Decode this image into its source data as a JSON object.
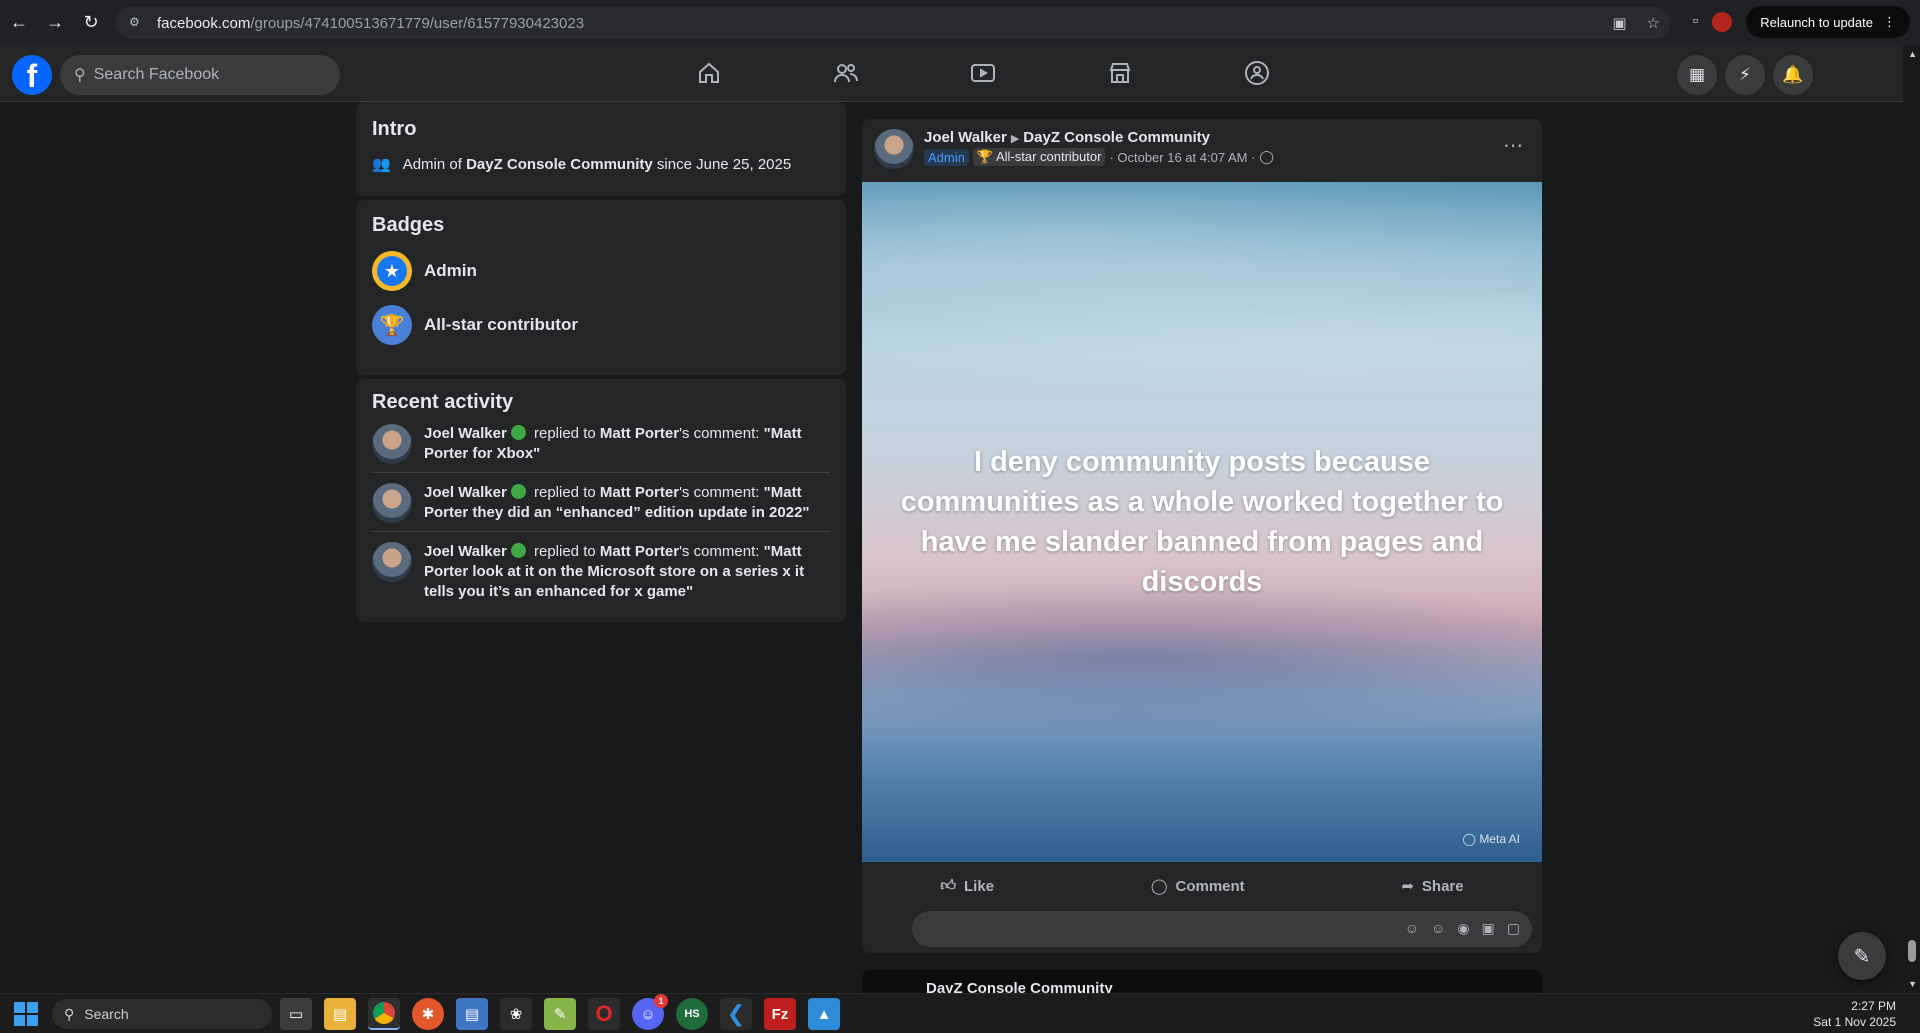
{
  "browser": {
    "url_host": "facebook.com",
    "url_path": "/groups/474100513671779/user/61577930423023",
    "relaunch_label": "Relaunch to update"
  },
  "header": {
    "search_placeholder": "Search Facebook",
    "nav": [
      "home",
      "friends",
      "watch",
      "marketplace",
      "groups"
    ]
  },
  "intro": {
    "title": "Intro",
    "prefix": "Admin of ",
    "group": "DayZ Console Community",
    "suffix": " since June 25, 2025"
  },
  "badges": {
    "title": "Badges",
    "items": [
      {
        "label": "Admin",
        "icon": "star-badge-icon"
      },
      {
        "label": "All-star contributor",
        "icon": "trophy-badge-icon"
      }
    ]
  },
  "activity": {
    "title": "Recent activity",
    "items": [
      {
        "actor": "Joel Walker",
        "verb": " replied to ",
        "target": "Matt Porter",
        "possessive": "'s comment: ",
        "quote": "\"Matt Porter for Xbox\""
      },
      {
        "actor": "Joel Walker",
        "verb": " replied to ",
        "target": "Matt Porter",
        "possessive": "'s comment: ",
        "quote": "\"Matt Porter they did an “enhanced” edition update in 2022\""
      },
      {
        "actor": "Joel Walker",
        "verb": " replied to ",
        "target": "Matt Porter",
        "possessive": "'s comment: ",
        "quote": "\"Matt Porter look at it on the Microsoft store on a series x it tells you it’s an enhanced for x game\""
      }
    ]
  },
  "post": {
    "author": "Joel Walker",
    "group": "DayZ Console Community",
    "admin_tag": "Admin",
    "allstar_tag": "All-star contributor",
    "time": "· October 16 at 4:07 AM ·",
    "image_text": "I deny community posts because communities as a whole worked together to have me slander banned from pages and discords",
    "watermark": "Meta AI",
    "actions": {
      "like": "Like",
      "comment": "Comment",
      "share": "Share"
    }
  },
  "next_post": {
    "title": "DayZ Console Community"
  },
  "taskbar": {
    "search_label": "Search",
    "time": "2:27 PM",
    "date": "Sat 1 Nov 2025",
    "discord_badge": "1"
  }
}
